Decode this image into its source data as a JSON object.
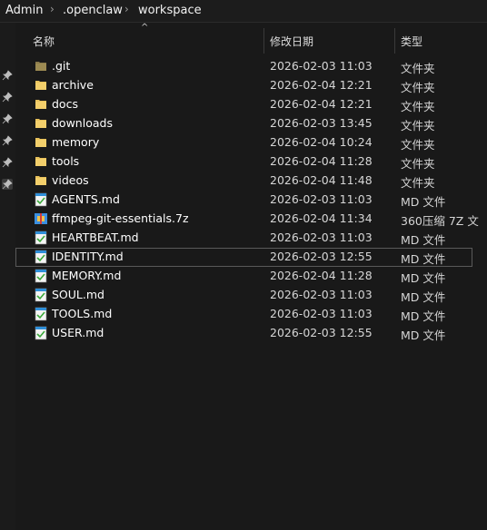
{
  "breadcrumb": {
    "items": [
      "Admin",
      ".openclaw",
      "workspace"
    ],
    "separator": "›"
  },
  "columns": {
    "name": "名称",
    "modified": "修改日期",
    "type": "类型"
  },
  "colors": {
    "background": "#191919",
    "folder": "#e8c15a",
    "hidden_folder": "#8a7a4a"
  },
  "files": [
    {
      "name": ".git",
      "modified": "2026-02-03 11:03",
      "type": "文件夹",
      "icon": "hidden-folder-icon"
    },
    {
      "name": "archive",
      "modified": "2026-02-04 12:21",
      "type": "文件夹",
      "icon": "folder-icon"
    },
    {
      "name": "docs",
      "modified": "2026-02-04 12:21",
      "type": "文件夹",
      "icon": "folder-icon"
    },
    {
      "name": "downloads",
      "modified": "2026-02-03 13:45",
      "type": "文件夹",
      "icon": "folder-icon"
    },
    {
      "name": "memory",
      "modified": "2026-02-04 10:24",
      "type": "文件夹",
      "icon": "folder-icon"
    },
    {
      "name": "tools",
      "modified": "2026-02-04 11:28",
      "type": "文件夹",
      "icon": "folder-icon"
    },
    {
      "name": "videos",
      "modified": "2026-02-04 11:48",
      "type": "文件夹",
      "icon": "folder-icon"
    },
    {
      "name": "AGENTS.md",
      "modified": "2026-02-03 11:03",
      "type": "MD 文件",
      "icon": "markdown-file-icon"
    },
    {
      "name": "ffmpeg-git-essentials.7z",
      "modified": "2026-02-04 11:34",
      "type": "360压缩 7Z 文",
      "icon": "archive-file-icon"
    },
    {
      "name": "HEARTBEAT.md",
      "modified": "2026-02-03 11:03",
      "type": "MD 文件",
      "icon": "markdown-file-icon"
    },
    {
      "name": "IDENTITY.md",
      "modified": "2026-02-03 12:55",
      "type": "MD 文件",
      "icon": "markdown-file-icon",
      "selected": true
    },
    {
      "name": "MEMORY.md",
      "modified": "2026-02-04 11:28",
      "type": "MD 文件",
      "icon": "markdown-file-icon"
    },
    {
      "name": "SOUL.md",
      "modified": "2026-02-03 11:03",
      "type": "MD 文件",
      "icon": "markdown-file-icon"
    },
    {
      "name": "TOOLS.md",
      "modified": "2026-02-03 11:03",
      "type": "MD 文件",
      "icon": "markdown-file-icon"
    },
    {
      "name": "USER.md",
      "modified": "2026-02-03 12:55",
      "type": "MD 文件",
      "icon": "markdown-file-icon"
    }
  ]
}
